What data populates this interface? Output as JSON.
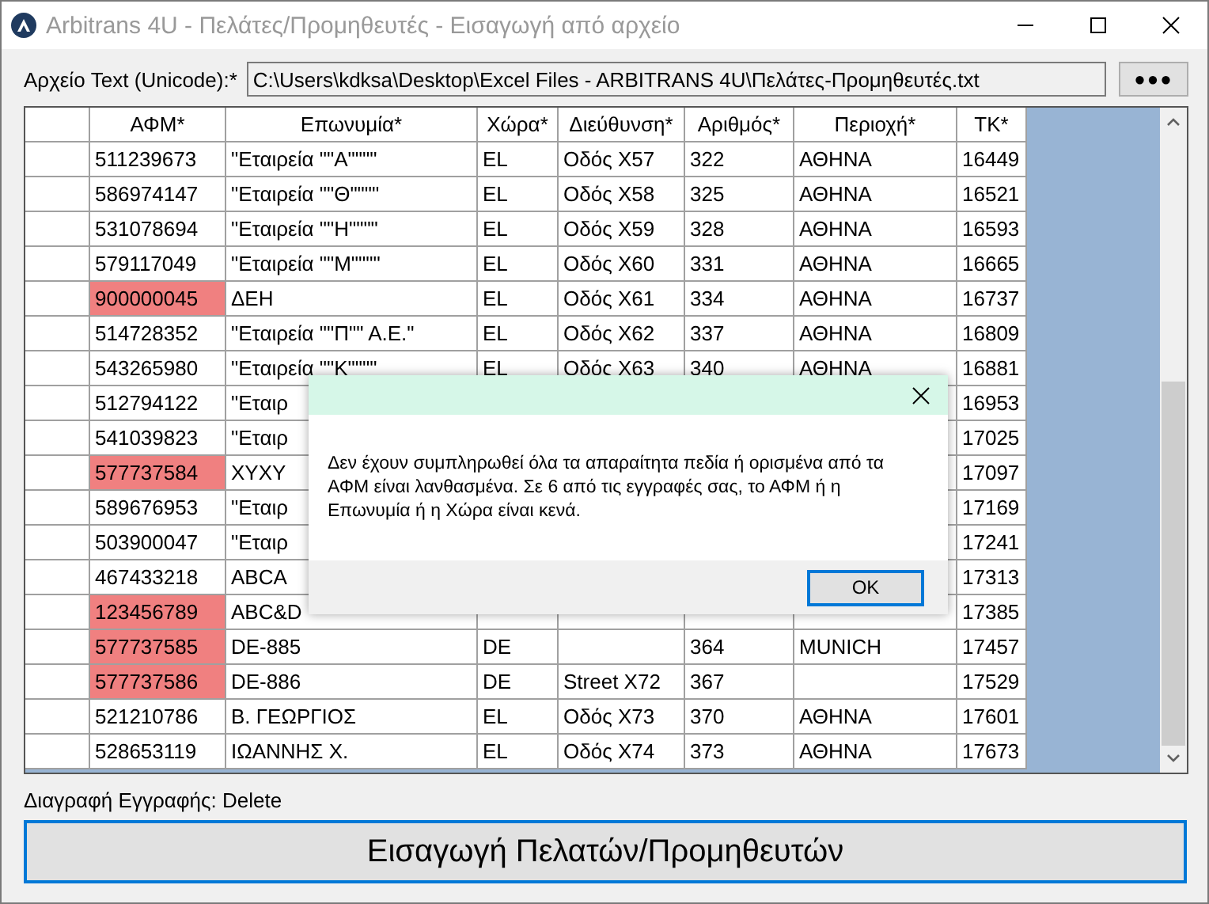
{
  "window": {
    "title": "Arbitrans 4U - Πελάτες/Προμηθευτές - Εισαγωγή από αρχείο"
  },
  "file": {
    "label": "Αρχείο Text (Unicode):*",
    "value": "C:\\Users\\kdksa\\Desktop\\Excel Files - ARBITRANS 4U\\Πελάτες-Προμηθευτές.txt",
    "browse": "●●●"
  },
  "table": {
    "columns": [
      "ΑΦΜ*",
      "Επωνυμία*",
      "Χώρα*",
      "Διεύθυνση*",
      "Αριθμός*",
      "Περιοχή*",
      "ΤΚ*"
    ],
    "rows": [
      {
        "invalid": false,
        "cells": [
          "511239673",
          "\"Εταιρεία \"\"Α\"\"\"\"",
          "EL",
          "Οδός X57",
          "322",
          "ΑΘΗΝΑ",
          "16449"
        ]
      },
      {
        "invalid": false,
        "cells": [
          "586974147",
          "\"Εταιρεία \"\"Θ\"\"\"\"",
          "EL",
          "Οδός X58",
          "325",
          "ΑΘΗΝΑ",
          "16521"
        ]
      },
      {
        "invalid": false,
        "cells": [
          "531078694",
          "\"Εταιρεία \"\"Η\"\"\"\"",
          "EL",
          "Οδός X59",
          "328",
          "ΑΘΗΝΑ",
          "16593"
        ]
      },
      {
        "invalid": false,
        "cells": [
          "579117049",
          "\"Εταιρεία \"\"Μ\"\"\"\"",
          "EL",
          "Οδός X60",
          "331",
          "ΑΘΗΝΑ",
          "16665"
        ]
      },
      {
        "invalid": true,
        "cells": [
          "900000045",
          "ΔΕΗ",
          "EL",
          "Οδός X61",
          "334",
          "ΑΘΗΝΑ",
          "16737"
        ]
      },
      {
        "invalid": false,
        "cells": [
          "514728352",
          "\"Εταιρεία \"\"Π\"\" Α.Ε.\"",
          "EL",
          "Οδός X62",
          "337",
          "ΑΘΗΝΑ",
          "16809"
        ]
      },
      {
        "invalid": false,
        "cells": [
          "543265980",
          "\"Εταιρεία \"\"Κ\"\"\"\"",
          "EL",
          "Οδός X63",
          "340",
          "ΑΘΗΝΑ",
          "16881"
        ]
      },
      {
        "invalid": false,
        "cells": [
          "512794122",
          "\"Εταιρ",
          null,
          null,
          null,
          null,
          "16953"
        ]
      },
      {
        "invalid": false,
        "cells": [
          "541039823",
          "\"Εταιρ",
          null,
          null,
          null,
          null,
          "17025"
        ]
      },
      {
        "invalid": true,
        "cells": [
          "577737584",
          "XYXY",
          null,
          null,
          null,
          null,
          "17097"
        ]
      },
      {
        "invalid": false,
        "cells": [
          "589676953",
          "\"Εταιρ",
          null,
          null,
          null,
          null,
          "17169"
        ]
      },
      {
        "invalid": false,
        "cells": [
          "503900047",
          "\"Εταιρ",
          null,
          null,
          null,
          null,
          "17241"
        ]
      },
      {
        "invalid": false,
        "cells": [
          "467433218",
          "ABCA",
          null,
          null,
          null,
          null,
          "17313"
        ]
      },
      {
        "invalid": true,
        "cells": [
          "123456789",
          "ABC&D",
          null,
          null,
          null,
          null,
          "17385"
        ]
      },
      {
        "invalid": true,
        "cells": [
          "577737585",
          "DE-885",
          "DE",
          null,
          "364",
          "MUNICH",
          "17457"
        ]
      },
      {
        "invalid": true,
        "cells": [
          "577737586",
          "DE-886",
          "DE",
          "Street X72",
          "367",
          null,
          "17529"
        ]
      },
      {
        "invalid": false,
        "cells": [
          "521210786",
          "Β. ΓΕΩΡΓΙΟΣ",
          "EL",
          "Οδός X73",
          "370",
          "ΑΘΗΝΑ",
          "17601"
        ]
      },
      {
        "invalid": false,
        "cells": [
          "528653119",
          "ΙΩΑΝΝΗΣ Χ.",
          "EL",
          "Οδός X74",
          "373",
          "ΑΘΗΝΑ",
          "17673"
        ]
      }
    ]
  },
  "hint": "Διαγραφή Εγγραφής: Delete",
  "import_button": "Εισαγωγή Πελατών/Προμηθευτών",
  "dialog": {
    "message": "Δεν έχουν συμπληρωθεί όλα τα απαραίτητα πεδία ή ορισμένα από τα ΑΦΜ είναι λανθασμένα. Σε 6 από τις εγγραφές σας, το ΑΦΜ ή η Επωνυμία ή η Χώρα είναι κενά.",
    "ok": "OK"
  }
}
